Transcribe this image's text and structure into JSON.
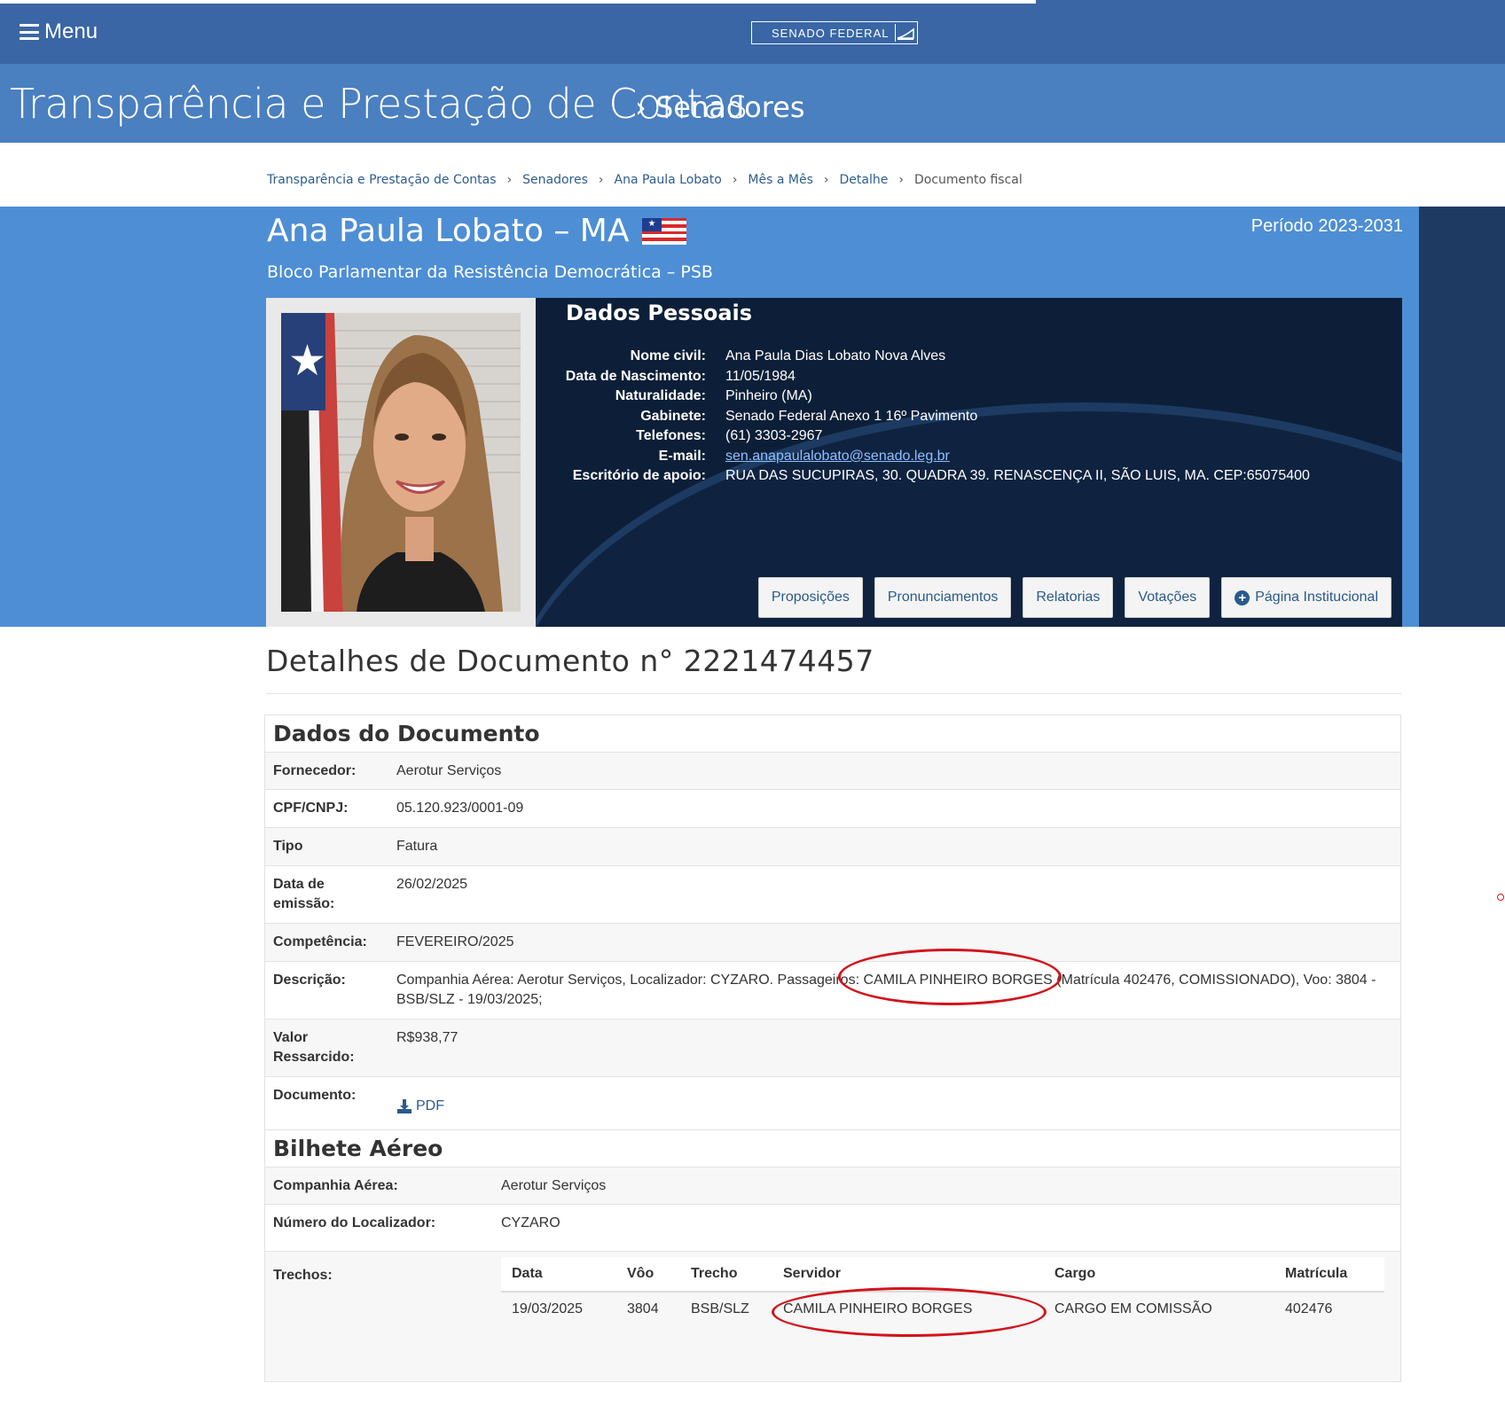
{
  "header": {
    "menu_label": "Menu",
    "logo_text": "SENADO FEDERAL",
    "site_title": "Transparência e Prestação de Contas",
    "site_section": "› Senadores"
  },
  "breadcrumb": [
    "Transparência e Prestação de Contas",
    "Senadores",
    "Ana Paula Lobato",
    "Mês a Mês",
    "Detalhe",
    "Documento fiscal"
  ],
  "senator": {
    "name": "Ana Paula Lobato – MA",
    "party": "Bloco Parlamentar da Resistência Democrática – PSB",
    "period": "Período 2023-2031"
  },
  "personal": {
    "heading": "Dados Pessoais",
    "rows": [
      {
        "label": "Nome civil:",
        "value": "Ana Paula Dias Lobato Nova Alves"
      },
      {
        "label": "Data de Nascimento:",
        "value": "11/05/1984"
      },
      {
        "label": "Naturalidade:",
        "value": "Pinheiro (MA)"
      },
      {
        "label": "Gabinete:",
        "value": "Senado Federal Anexo 1 16º Pavimento"
      },
      {
        "label": "Telefones:",
        "value": "(61) 3303-2967"
      },
      {
        "label": "E-mail:",
        "value": "sen.anapaulalobato@senado.leg.br"
      },
      {
        "label": "Escritório de apoio:",
        "value": "RUA DAS SUCUPIRAS, 30. QUADRA 39. RENASCENÇA II, SÃO LUIS, MA. CEP:65075400"
      }
    ],
    "buttons": [
      "Proposições",
      "Pronunciamentos",
      "Relatorias",
      "Votações",
      "Página Institucional"
    ]
  },
  "document": {
    "title": "Detalhes de Documento n° 2221474457",
    "section_title": "Dados do Documento",
    "rows": [
      {
        "label": "Fornecedor:",
        "value": "Aerotur Serviços"
      },
      {
        "label": "CPF/CNPJ:",
        "value": "05.120.923/0001-09"
      },
      {
        "label": "Tipo",
        "value": "Fatura"
      },
      {
        "label": "Data de emissão:",
        "value": "26/02/2025"
      },
      {
        "label": "Competência:",
        "value": "FEVEREIRO/2025"
      },
      {
        "label": "Descrição:",
        "value": "Companhia Aérea: Aerotur Serviços, Localizador: CYZARO. Passageiros: CAMILA PINHEIRO BORGES (Matrícula 402476, COMISSIONADO), Voo: 3804 - BSB/SLZ - 19/03/2025;"
      },
      {
        "label": "Valor Ressarcido:",
        "value": "R$938,77"
      },
      {
        "label": "Documento:",
        "value": "PDF"
      }
    ]
  },
  "ticket": {
    "section_title": "Bilhete Aéreo",
    "rows": [
      {
        "label": "Companhia Aérea:",
        "value": "Aerotur Serviços"
      },
      {
        "label": "Número do Localizador:",
        "value": "CYZARO"
      }
    ],
    "trechos_label": "Trechos:",
    "columns": [
      "Data",
      "Vôo",
      "Trecho",
      "Servidor",
      "Cargo",
      "Matrícula"
    ],
    "segments": [
      [
        "19/03/2025",
        "3804",
        "BSB/SLZ",
        "CAMILA PINHEIRO BORGES",
        "CARGO EM COMISSÃO",
        "402476"
      ]
    ]
  },
  "colors": {
    "header": "#3a66a5",
    "title_bar": "#4a7fc0",
    "hero": "#4e8ed5",
    "annotation": "#d2141c"
  }
}
